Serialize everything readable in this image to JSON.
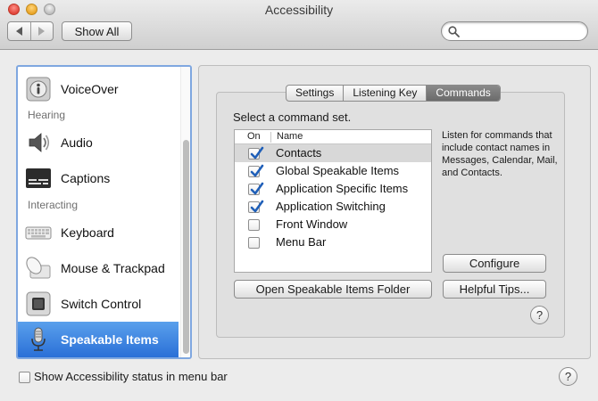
{
  "window": {
    "title": "Accessibility"
  },
  "toolbar": {
    "show_all_label": "Show All",
    "search_placeholder": ""
  },
  "sidebar": {
    "items": [
      {
        "label": "VoiceOver",
        "icon": "voiceover-icon"
      },
      {
        "label": "Audio",
        "icon": "speaker-icon"
      },
      {
        "label": "Captions",
        "icon": "captions-icon"
      },
      {
        "label": "Keyboard",
        "icon": "keyboard-icon"
      },
      {
        "label": "Mouse & Trackpad",
        "icon": "mouse-icon"
      },
      {
        "label": "Switch Control",
        "icon": "switch-control-icon"
      },
      {
        "label": "Speakable Items",
        "icon": "microphone-icon",
        "selected": true
      }
    ],
    "headers": {
      "hearing": "Hearing",
      "interacting": "Interacting"
    }
  },
  "tabs": [
    {
      "label": "Settings",
      "active": false
    },
    {
      "label": "Listening Key",
      "active": false
    },
    {
      "label": "Commands",
      "active": true
    }
  ],
  "commands": {
    "instruction": "Select a command set.",
    "columns": {
      "on": "On",
      "name": "Name"
    },
    "rows": [
      {
        "name": "Contacts",
        "checked": true,
        "selected": true
      },
      {
        "name": "Global Speakable Items",
        "checked": true
      },
      {
        "name": "Application Specific Items",
        "checked": true
      },
      {
        "name": "Application Switching",
        "checked": true
      },
      {
        "name": "Front Window",
        "checked": false
      },
      {
        "name": "Menu Bar",
        "checked": false
      }
    ],
    "description": "Listen for commands that include contact names in Messages, Calendar, Mail, and Contacts.",
    "configure_label": "Configure",
    "open_folder_label": "Open Speakable Items Folder",
    "helpful_tips_label": "Helpful Tips...",
    "help_label": "?"
  },
  "footer": {
    "status_label": "Show Accessibility status in menu bar",
    "status_checked": false,
    "help_label": "?"
  },
  "colors": {
    "selection_blue": "#2a6fd7",
    "checkmark_blue": "#1f5fb8",
    "panel_gray": "#e6e6e6"
  }
}
